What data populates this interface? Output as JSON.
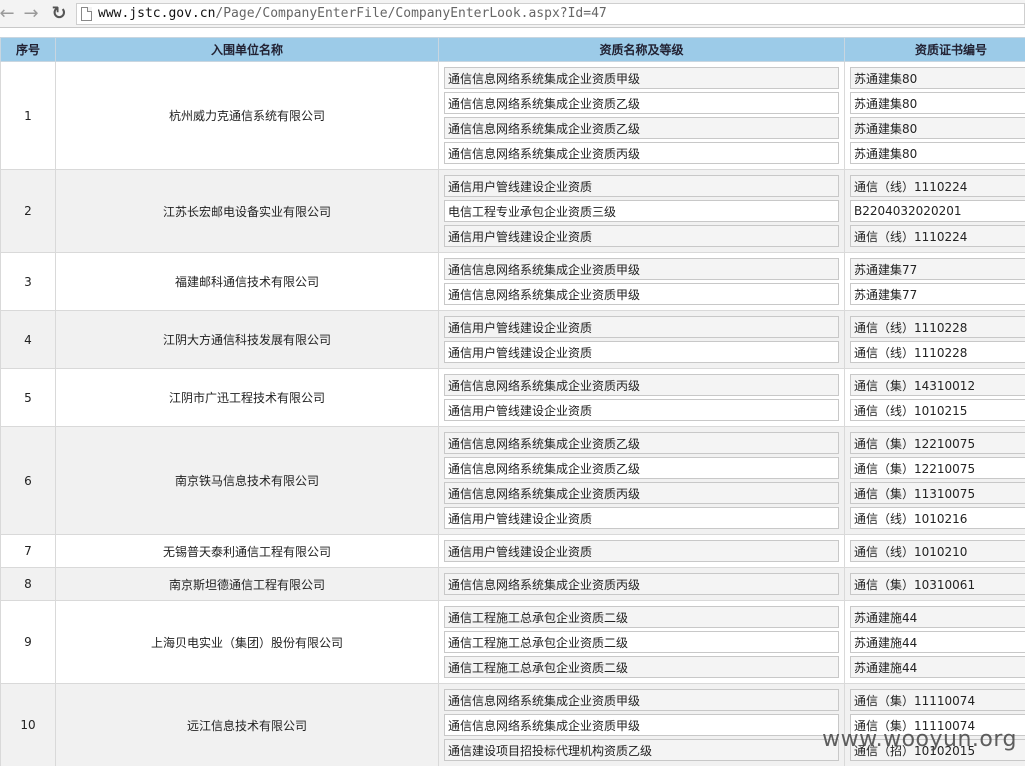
{
  "browser": {
    "back_icon": "back-arrow-icon",
    "forward_icon": "forward-arrow-icon",
    "reload_icon": "reload-icon",
    "url_host": "www.jstc.gov.cn",
    "url_path": "/Page/CompanyEnterFile/CompanyEnterLook.aspx?Id=47"
  },
  "table": {
    "headers": [
      "序号",
      "入围单位名称",
      "资质名称及等级",
      "资质证书编号"
    ],
    "rows": [
      {
        "no": "1",
        "company": "杭州威力克通信系统有限公司",
        "qualifications": [
          "通信信息网络系统集成企业资质甲级",
          "通信信息网络系统集成企业资质乙级",
          "通信信息网络系统集成企业资质乙级",
          "通信信息网络系统集成企业资质丙级"
        ],
        "certs": [
          "苏通建集80",
          "苏通建集80",
          "苏通建集80",
          "苏通建集80"
        ]
      },
      {
        "no": "2",
        "company": "江苏长宏邮电设备实业有限公司",
        "qualifications": [
          "通信用户管线建设企业资质",
          "电信工程专业承包企业资质三级",
          "通信用户管线建设企业资质"
        ],
        "certs": [
          "通信（线）1110224",
          "B2204032020201",
          "通信（线）1110224"
        ]
      },
      {
        "no": "3",
        "company": "福建邮科通信技术有限公司",
        "qualifications": [
          "通信信息网络系统集成企业资质甲级",
          "通信信息网络系统集成企业资质甲级"
        ],
        "certs": [
          "苏通建集77",
          "苏通建集77"
        ]
      },
      {
        "no": "4",
        "company": "江阴大方通信科技发展有限公司",
        "qualifications": [
          "通信用户管线建设企业资质",
          "通信用户管线建设企业资质"
        ],
        "certs": [
          "通信（线）1110228",
          "通信（线）1110228"
        ]
      },
      {
        "no": "5",
        "company": "江阴市广迅工程技术有限公司",
        "qualifications": [
          "通信信息网络系统集成企业资质丙级",
          "通信用户管线建设企业资质"
        ],
        "certs": [
          "通信（集）14310012",
          "通信（线）1010215"
        ]
      },
      {
        "no": "6",
        "company": "南京铁马信息技术有限公司",
        "qualifications": [
          "通信信息网络系统集成企业资质乙级",
          "通信信息网络系统集成企业资质乙级",
          "通信信息网络系统集成企业资质丙级",
          "通信用户管线建设企业资质"
        ],
        "certs": [
          "通信（集）12210075",
          "通信（集）12210075",
          "通信（集）11310075",
          "通信（线）1010216"
        ]
      },
      {
        "no": "7",
        "company": "无锡普天泰利通信工程有限公司",
        "qualifications": [
          "通信用户管线建设企业资质"
        ],
        "certs": [
          "通信（线）1010210"
        ]
      },
      {
        "no": "8",
        "company": "南京斯坦德通信工程有限公司",
        "qualifications": [
          "通信信息网络系统集成企业资质丙级"
        ],
        "certs": [
          "通信（集）10310061"
        ]
      },
      {
        "no": "9",
        "company": "上海贝电实业（集团）股份有限公司",
        "qualifications": [
          "通信工程施工总承包企业资质二级",
          "通信工程施工总承包企业资质二级",
          "通信工程施工总承包企业资质二级"
        ],
        "certs": [
          "苏通建施44",
          "苏通建施44",
          "苏通建施44"
        ]
      },
      {
        "no": "10",
        "company": "远江信息技术有限公司",
        "qualifications": [
          "通信信息网络系统集成企业资质甲级",
          "通信信息网络系统集成企业资质甲级",
          "通信建设项目招投标代理机构资质乙级"
        ],
        "certs": [
          "通信（集）11110074",
          "通信（集）11110074",
          "通信（招）10102015"
        ]
      }
    ]
  },
  "watermark": "www.wooyun.org"
}
